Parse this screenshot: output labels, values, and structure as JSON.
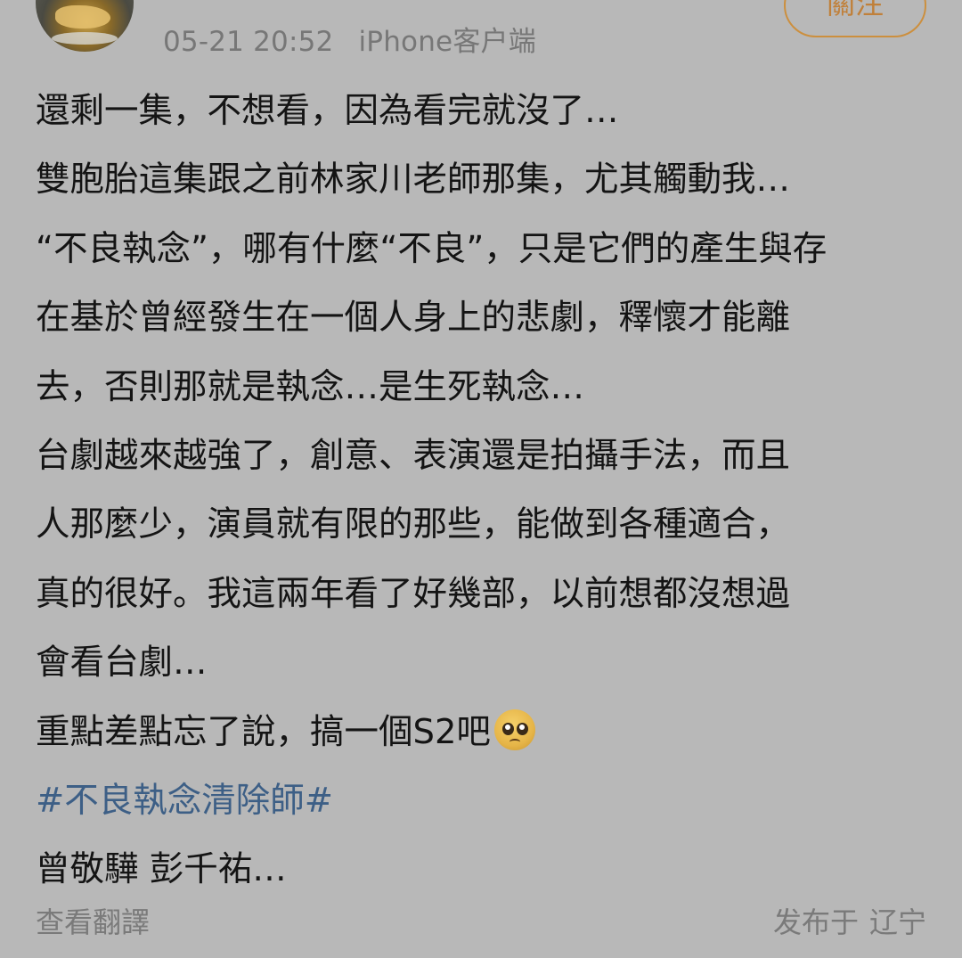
{
  "post": {
    "timestamp": "05-21 20:52",
    "client": "iPhone客户端",
    "follow_label": "關注",
    "lines": [
      "還剩一集，不想看，因為看完就沒了…",
      "雙胞胎這集跟之前林家川老師那集，尤其觸動我…",
      "“不良執念”，哪有什麼“不良”，只是它們的產生與存",
      "在基於曾經發生在一個人身上的悲劇，釋懷才能離",
      "去，否則那就是執念…是生死執念…",
      "台劇越來越強了，創意、表演還是拍攝手法，而且",
      "人那麼少，演員就有限的那些，能做到各種適合，",
      "真的很好。我這兩年看了好幾部，以前想都沒想過",
      "會看台劇…"
    ],
    "line_with_emoji": "重點差點忘了說，搞一個S2吧",
    "emoji_icon": "pleading-face-emoji",
    "hashtag": "#不良執念清除師#",
    "mentions": "曾敬驊 彭千祐…"
  },
  "footer": {
    "translate_label": "查看翻譯",
    "location_prefix": "发布于",
    "location": "辽宁"
  },
  "colors": {
    "background": "#b8b8b8",
    "text": "#141414",
    "hashtag": "#3d5f86",
    "meta": "#777777",
    "follow_border": "#cc8f3e"
  }
}
